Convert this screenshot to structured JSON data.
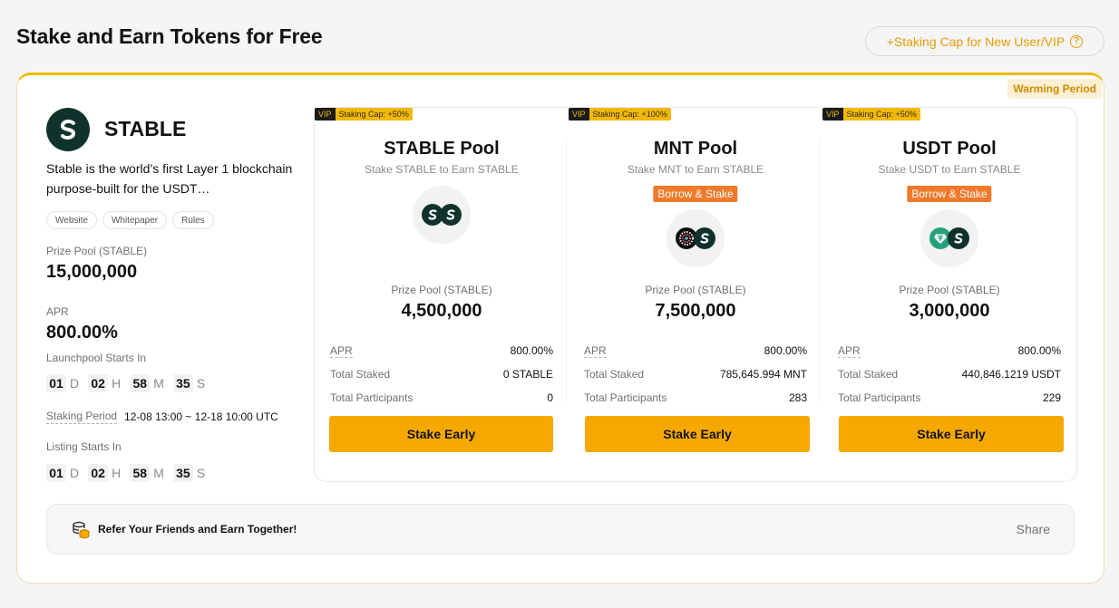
{
  "header": {
    "title": "Stake and Earn Tokens for Free",
    "cap_button": "+Staking Cap for New User/VIP",
    "help_icon": "question-circle-icon"
  },
  "card": {
    "status_badge": "Warming Period",
    "token": {
      "name": "STABLE",
      "description": "Stable is the world’s first Layer 1 blockchain purpose-built for the USDT…",
      "links": [
        "Website",
        "Whitepaper",
        "Rules"
      ]
    },
    "prize_pool_label": "Prize Pool (STABLE)",
    "prize_pool_value": "15,000,000",
    "apr_label": "APR",
    "apr_value": "800.00%",
    "launch_label": "Launchpool Starts In",
    "launch_countdown": {
      "d": "01",
      "h": "02",
      "m": "58",
      "s": "35"
    },
    "units": {
      "d": "D",
      "h": "H",
      "m": "M",
      "s": "S"
    },
    "staking_period_label": "Staking Period",
    "staking_period_value": "12-08 13:00 ~ 12-18 10:00 UTC",
    "listing_label": "Listing Starts In",
    "listing_countdown": {
      "d": "01",
      "h": "02",
      "m": "58",
      "s": "35"
    }
  },
  "pools": [
    {
      "vip": "VIP",
      "cap": "Staking Cap: +50%",
      "name": "STABLE Pool",
      "subtitle": "Stake STABLE to Earn STABLE",
      "prize_label": "Prize Pool (STABLE)",
      "prize_value": "4,500,000",
      "apr_label": "APR",
      "apr": "800.00%",
      "staked_label": "Total Staked",
      "staked": "0 STABLE",
      "participants_label": "Total Participants",
      "participants": "0",
      "button": "Stake Early"
    },
    {
      "vip": "VIP",
      "cap": "Staking Cap: +100%",
      "name": "MNT Pool",
      "subtitle": "Stake MNT to Earn STABLE",
      "badge": "Borrow & Stake",
      "prize_label": "Prize Pool (STABLE)",
      "prize_value": "7,500,000",
      "apr_label": "APR",
      "apr": "800.00%",
      "staked_label": "Total Staked",
      "staked": "785,645.994 MNT",
      "participants_label": "Total Participants",
      "participants": "283",
      "button": "Stake Early"
    },
    {
      "vip": "VIP",
      "cap": "Staking Cap: +50%",
      "name": "USDT Pool",
      "subtitle": "Stake USDT to Earn STABLE",
      "badge": "Borrow & Stake",
      "prize_label": "Prize Pool (STABLE)",
      "prize_value": "3,000,000",
      "apr_label": "APR",
      "apr": "800.00%",
      "staked_label": "Total Staked",
      "staked": "440,846.1219 USDT",
      "participants_label": "Total Participants",
      "participants": "229",
      "button": "Stake Early"
    }
  ],
  "referral": {
    "text": "Refer Your Friends and Earn Together!",
    "share": "Share",
    "icon": "coins-icon"
  },
  "colors": {
    "accent": "#f5a800",
    "card_top_border": "#f0b90b",
    "badge_orange": "#f07a2a",
    "brand_dark_green": "#0f332a"
  }
}
